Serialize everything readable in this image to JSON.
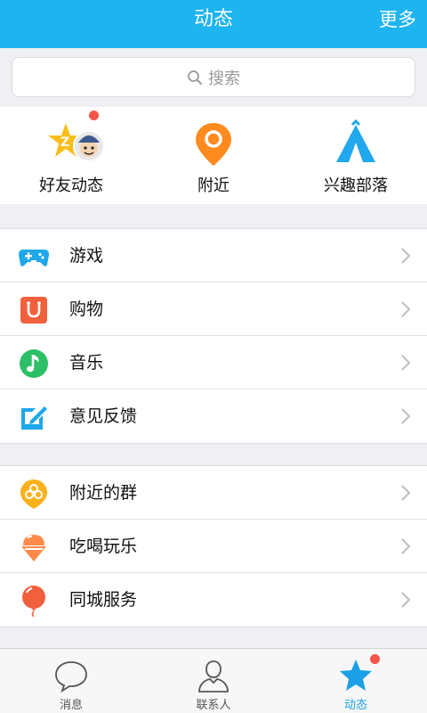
{
  "header": {
    "title": "动态",
    "more": "更多"
  },
  "search": {
    "placeholder": "搜索"
  },
  "quick": [
    {
      "label": "好友动态",
      "icon": "friends-feed-icon",
      "badge": true
    },
    {
      "label": "附近",
      "icon": "location-pin-icon",
      "badge": false
    },
    {
      "label": "兴趣部落",
      "icon": "tribe-tent-icon",
      "badge": false
    }
  ],
  "group1": [
    {
      "label": "游戏",
      "icon": "gamepad-icon"
    },
    {
      "label": "购物",
      "icon": "shopping-bag-icon"
    },
    {
      "label": "音乐",
      "icon": "music-note-icon"
    },
    {
      "label": "意见反馈",
      "icon": "feedback-icon"
    }
  ],
  "group2": [
    {
      "label": "附近的群",
      "icon": "nearby-group-icon"
    },
    {
      "label": "吃喝玩乐",
      "icon": "ice-cream-icon"
    },
    {
      "label": "同城服务",
      "icon": "balloon-icon"
    }
  ],
  "tabs": [
    {
      "label": "消息",
      "icon": "chat-bubble-icon",
      "active": false
    },
    {
      "label": "联系人",
      "icon": "contacts-person-icon",
      "active": false
    },
    {
      "label": "动态",
      "icon": "star-icon",
      "active": true,
      "badge": true
    }
  ],
  "colors": {
    "header": "#1eb4f0",
    "accent": "#1ba0e6",
    "badge": "#f5544a"
  }
}
